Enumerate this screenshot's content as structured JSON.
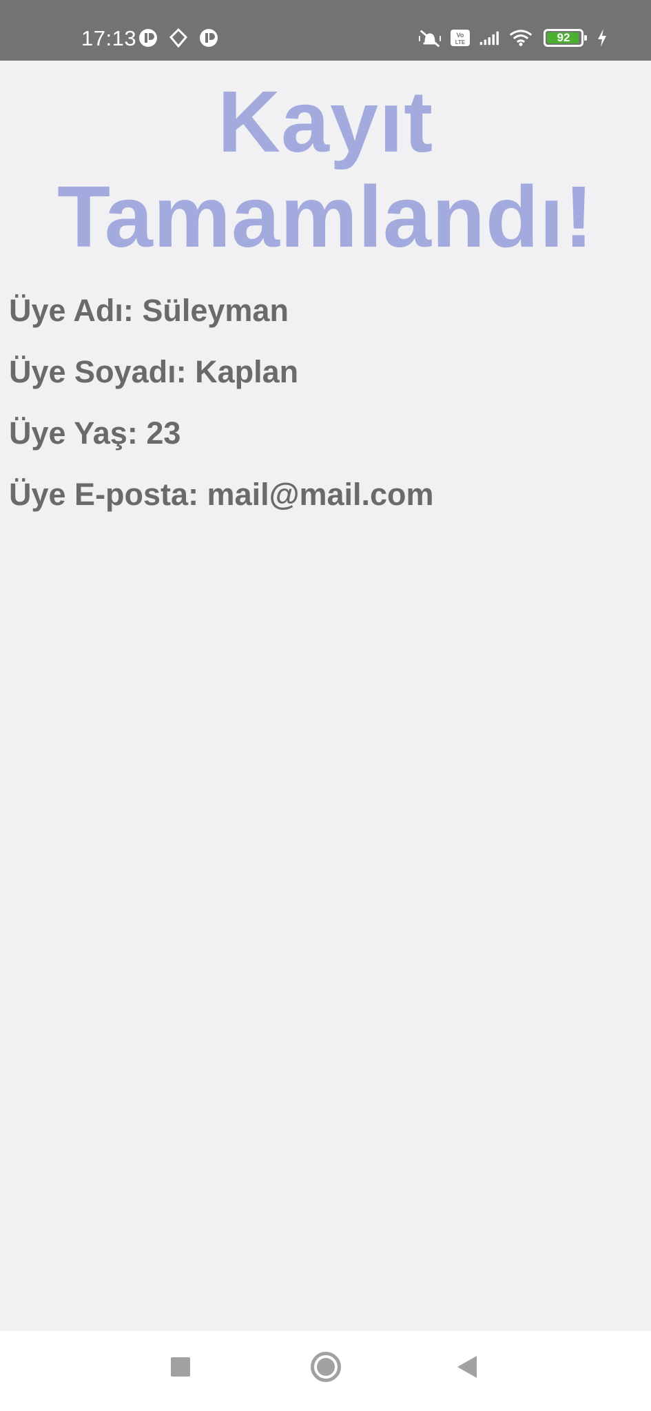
{
  "status_bar": {
    "time": "17:13",
    "battery_level": "92",
    "battery_color": "#4caf32",
    "left_icons": [
      "notification-app-icon",
      "location-off-icon",
      "notification-app-icon"
    ],
    "right_icons": [
      "vibrate-silent-icon",
      "volte-icon",
      "signal-icon",
      "wifi-icon",
      "battery-icon",
      "charging-icon"
    ]
  },
  "main": {
    "title": "Kayıt Tamamlandı!",
    "title_color": "#a3aadd",
    "info": {
      "name": "Üye Adı: Süleyman",
      "surname": "Üye Soyadı: Kaplan",
      "age": "Üye Yaş: 23",
      "email": "Üye E-posta: mail@mail.com"
    }
  },
  "nav_bar": {
    "buttons": [
      "recents-button",
      "home-button",
      "back-button"
    ]
  }
}
